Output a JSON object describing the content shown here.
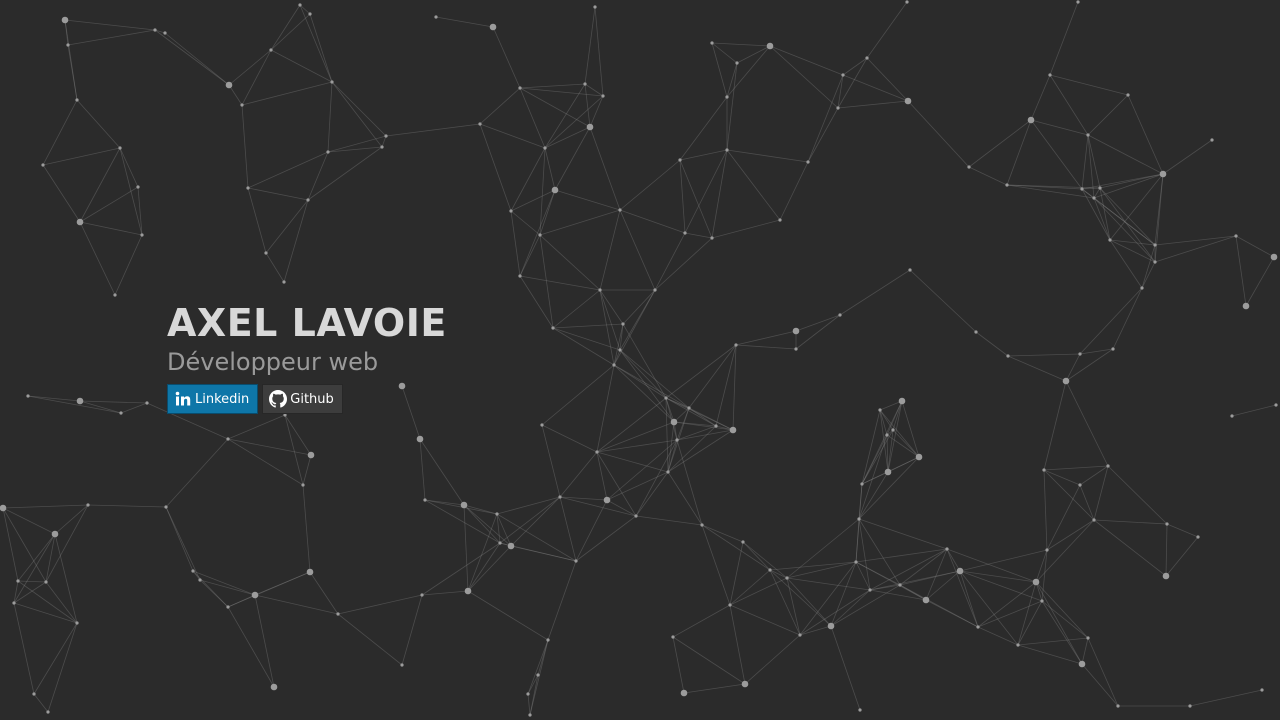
{
  "profile": {
    "name": "AXEL LAVOIE",
    "role": "Développeur web"
  },
  "links": {
    "linkedin": {
      "label": "Linkedin",
      "icon": "linkedin-icon",
      "color": "#0e76a8"
    },
    "github": {
      "label": "Github",
      "icon": "github-icon",
      "color": "#3d3d3d"
    }
  },
  "background": {
    "type": "particle-network",
    "background_color": "#2b2b2b",
    "node_color": "#9c9c9c",
    "line_color": "#8a8a8a"
  }
}
